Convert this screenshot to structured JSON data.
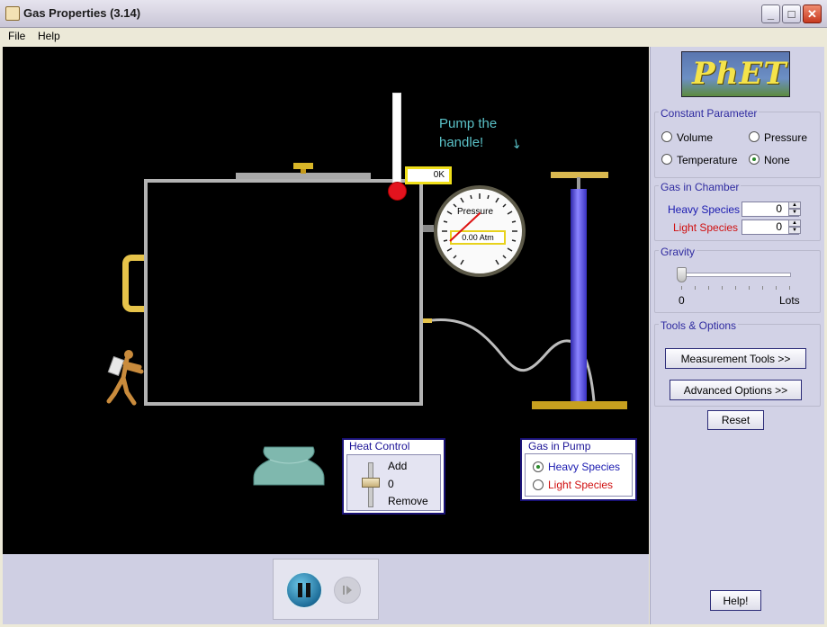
{
  "window": {
    "title": "Gas Properties (3.14)",
    "minimize": "_",
    "maximize": "□",
    "close": "✕"
  },
  "menu": {
    "items": [
      "File",
      "Help"
    ]
  },
  "sim": {
    "thermometer_readout": "0K",
    "pump_hint": [
      "Pump the",
      "handle!"
    ],
    "pump_hint_arrow": "↘",
    "gauge": {
      "label": "Pressure",
      "readout": "0.00 Atm"
    }
  },
  "heat_control": {
    "title": "Heat Control",
    "add": "Add",
    "zero": "0",
    "remove": "Remove",
    "level": 0
  },
  "gas_in_pump": {
    "title": "Gas in Pump",
    "options": [
      {
        "label": "Heavy Species",
        "color": "#1a1ab0",
        "selected": true
      },
      {
        "label": "Light Species",
        "color": "#d01010",
        "selected": false
      }
    ]
  },
  "clock": {
    "pause_icon": "pause-icon",
    "step_icon": "step-icon"
  },
  "side": {
    "logo": "PhET",
    "constant_parameter": {
      "title": "Constant Parameter",
      "options": [
        "Volume",
        "Pressure",
        "Temperature",
        "None"
      ],
      "selected": "None"
    },
    "gas_in_chamber": {
      "title": "Gas in Chamber",
      "heavy": {
        "label": "Heavy Species",
        "value": "0",
        "color": "#1a1ab0"
      },
      "light": {
        "label": "Light Species",
        "value": "0",
        "color": "#d01010"
      }
    },
    "gravity": {
      "title": "Gravity",
      "min": "0",
      "max": "Lots",
      "level": 0
    },
    "tools": {
      "title": "Tools & Options",
      "measurement": "Measurement Tools >>",
      "advanced": "Advanced Options >>"
    },
    "reset": "Reset",
    "help": "Help!"
  }
}
